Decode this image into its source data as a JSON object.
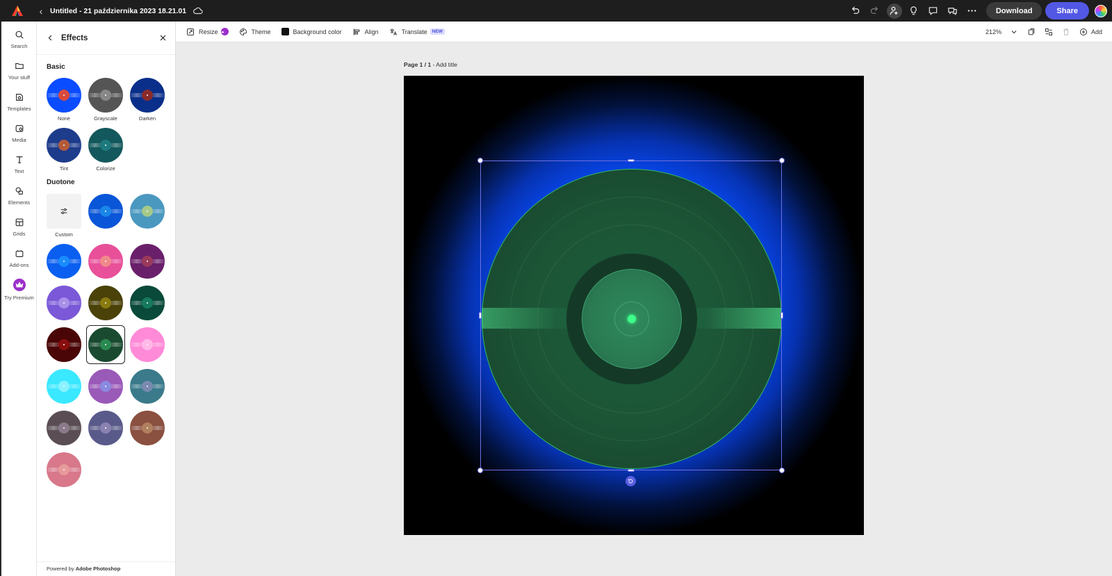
{
  "topbar": {
    "doc_title": "Untitled - 21 października 2023 18.21.01",
    "download_label": "Download",
    "share_label": "Share"
  },
  "rail": {
    "items": [
      {
        "label": "Search",
        "icon": "search-icon"
      },
      {
        "label": "Your stuff",
        "icon": "folder-icon"
      },
      {
        "label": "Templates",
        "icon": "templates-icon"
      },
      {
        "label": "Media",
        "icon": "media-icon"
      },
      {
        "label": "Text",
        "icon": "text-icon"
      },
      {
        "label": "Elements",
        "icon": "elements-icon"
      },
      {
        "label": "Grids",
        "icon": "grids-icon"
      },
      {
        "label": "Add-ons",
        "icon": "addons-icon"
      },
      {
        "label": "Try Premium",
        "icon": "crown-icon"
      }
    ]
  },
  "panel": {
    "title": "Effects",
    "basic_title": "Basic",
    "duotone_title": "Duotone",
    "basic": [
      {
        "label": "None",
        "disc": "#0a4cff",
        "center": "#d94a3e"
      },
      {
        "label": "Grayscale",
        "disc": "#555555",
        "center": "#888888"
      },
      {
        "label": "Darken",
        "disc": "#0a2f8a",
        "center": "#8a2b2b"
      },
      {
        "label": "Tint",
        "disc": "#1e3c8c",
        "center": "#b35a3a"
      },
      {
        "label": "Colorize",
        "disc": "#13585c",
        "center": "#1d7a7e"
      }
    ],
    "custom_label": "Custom",
    "duotone": [
      {
        "disc": "#0a56d8",
        "center": "#1a86e8"
      },
      {
        "disc": "#4a98c0",
        "center": "#a6c98a"
      },
      {
        "disc": "#0a5ff0",
        "center": "#1a8cff"
      },
      {
        "disc": "#e8509a",
        "center": "#f08a8a"
      },
      {
        "disc": "#6a1f6a",
        "center": "#9a3a5a"
      },
      {
        "disc": "#7a58d8",
        "center": "#a890e8"
      },
      {
        "disc": "#4a4208",
        "center": "#8a7a10"
      },
      {
        "disc": "#0a4a3a",
        "center": "#167a5e"
      },
      {
        "disc": "#4a0606",
        "center": "#8a0e0e"
      },
      {
        "disc": "#1a4a30",
        "center": "#2a8a50"
      },
      {
        "disc": "#ff8ad8",
        "center": "#ffb8e8"
      },
      {
        "disc": "#3ae8ff",
        "center": "#8af2ff"
      },
      {
        "disc": "#9a5ab8",
        "center": "#8a8ae0"
      },
      {
        "disc": "#3a7a8a",
        "center": "#7a8ab0"
      },
      {
        "disc": "#5a4e54",
        "center": "#8a7a8a"
      },
      {
        "disc": "#5a5a8a",
        "center": "#8a82b0"
      },
      {
        "disc": "#8a5040",
        "center": "#b08060"
      },
      {
        "disc": "#d8788a",
        "center": "#e89a9a"
      }
    ],
    "selected_duotone_index": 9,
    "powered_prefix": "Powered by ",
    "powered_brand": "Adobe Photoshop"
  },
  "toolbar": {
    "resize": "Resize",
    "theme": "Theme",
    "background_color": "Background color",
    "align": "Align",
    "translate": "Translate",
    "new_badge": "NEW",
    "zoom": "212%",
    "add": "Add"
  },
  "canvas": {
    "page_label": "Page 1 / 1",
    "page_suffix": " - Add title"
  }
}
